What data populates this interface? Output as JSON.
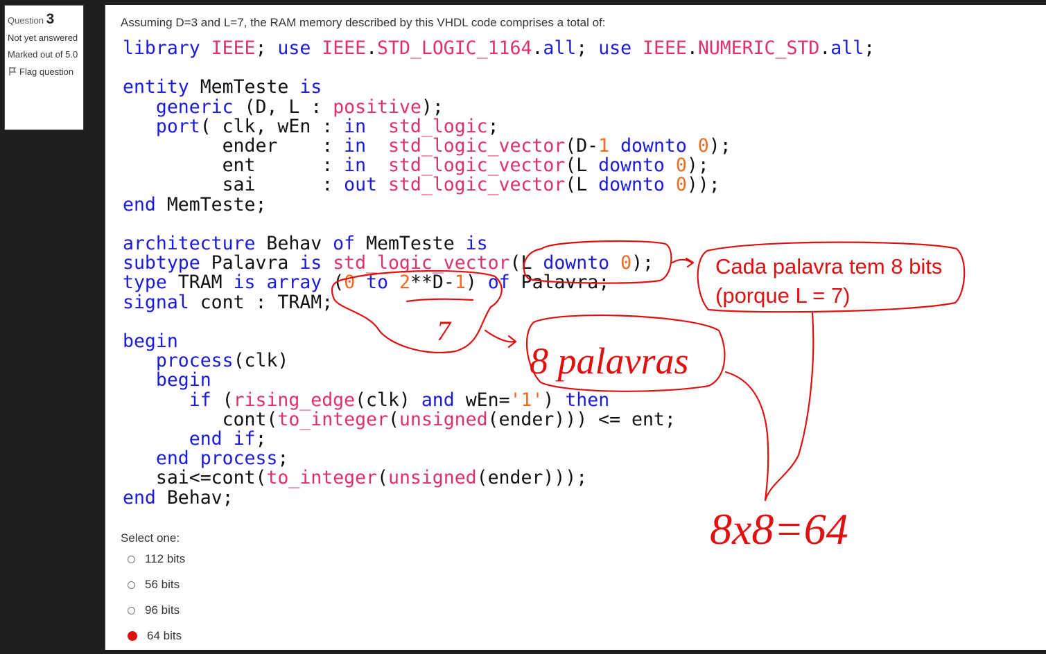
{
  "sidebar": {
    "question_label": "Question",
    "question_number": "3",
    "status": "Not yet answered",
    "marked": "Marked out of 5.0",
    "flag": "Flag question"
  },
  "question": {
    "text": "Assuming D=3 and L=7, the RAM memory described by this VHDL code comprises a total of:"
  },
  "code_lines": [
    "library IEEE; use IEEE.STD_LOGIC_1164.all; use IEEE.NUMERIC_STD.all;",
    "",
    "entity MemTeste is",
    "   generic (D, L : positive);",
    "   port( clk, wEn : in  std_logic;",
    "         ender    : in  std_logic_vector(D-1 downto 0);",
    "         ent      : in  std_logic_vector(L downto 0);",
    "         sai      : out std_logic_vector(L downto 0));",
    "end MemTeste;",
    "",
    "architecture Behav of MemTeste is",
    "subtype Palavra is std_logic_vector(L downto 0);",
    "type TRAM is array (0 to 2**D-1) of Palavra;",
    "signal cont : TRAM;",
    "",
    "begin",
    "   process(clk)",
    "   begin",
    "      if (rising_edge(clk) and wEn='1') then",
    "         cont(to_integer(unsigned(ender))) <= ent;",
    "      end if;",
    "   end process;",
    "   sai<=cont(to_integer(unsigned(ender)));",
    "end Behav;"
  ],
  "annotations": {
    "word_size_line1": "Cada palavra tem 8 bits",
    "word_size_line2": "(porque L = 7)",
    "index_value": "7",
    "word_count": "8 palavras",
    "result": "8x8=64"
  },
  "answers": {
    "select_label": "Select one:",
    "options": [
      {
        "label": "112 bits",
        "selected": false
      },
      {
        "label": "56 bits",
        "selected": false
      },
      {
        "label": "96 bits",
        "selected": false
      },
      {
        "label": "64 bits",
        "selected": true
      }
    ]
  },
  "colors": {
    "annotation": "#e01010",
    "keyword": "#1a1adb",
    "type": "#e0306a",
    "number": "#f26a21"
  }
}
